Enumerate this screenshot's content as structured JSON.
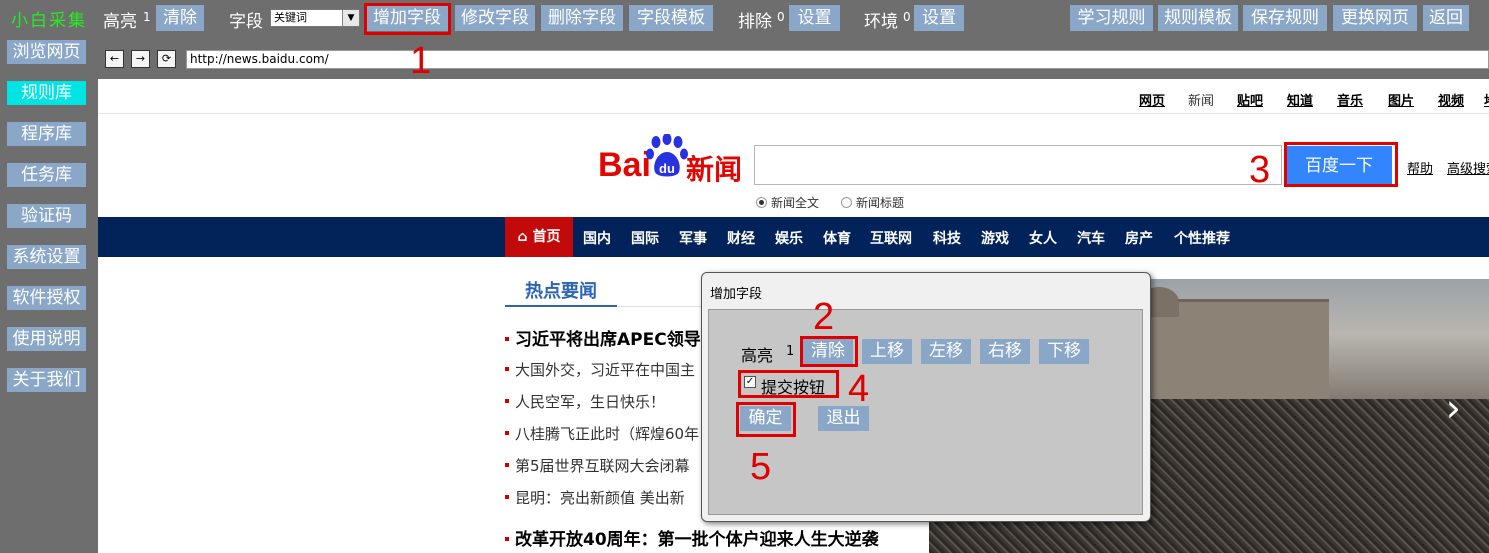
{
  "toolbar": {
    "brand": "小白采集",
    "highlight_label": "高亮",
    "highlight_count": "1",
    "clear": "清除",
    "field_label": "字段",
    "field_select": "关键词",
    "add_field": "增加字段",
    "edit_field": "修改字段",
    "delete_field": "删除字段",
    "field_template": "字段模板",
    "exclude_label": "排除",
    "exclude_count": "0",
    "exclude_settings": "设置",
    "env_label": "环境",
    "env_count": "0",
    "env_settings": "设置",
    "learn_rules": "学习规则",
    "rule_template": "规则模板",
    "save_rules": "保存规则",
    "change_page": "更换网页",
    "back": "返回"
  },
  "sidebar": {
    "items": [
      {
        "label": "浏览网页",
        "active": false
      },
      {
        "label": "规则库",
        "active": true
      },
      {
        "label": "程序库",
        "active": false
      },
      {
        "label": "任务库",
        "active": false
      },
      {
        "label": "验证码",
        "active": false
      },
      {
        "label": "系统设置",
        "active": false
      },
      {
        "label": "软件授权",
        "active": false
      },
      {
        "label": "使用说明",
        "active": false
      },
      {
        "label": "关于我们",
        "active": false
      }
    ]
  },
  "browser": {
    "back_glyph": "←",
    "forward_glyph": "→",
    "refresh_glyph": "⟳",
    "url": "http://news.baidu.com/"
  },
  "webpage": {
    "top_links": [
      "网页",
      "新闻",
      "贴吧",
      "知道",
      "音乐",
      "图片",
      "视频",
      "地"
    ],
    "logo_text": "Bai",
    "logo_du": "du",
    "logo_news": "新闻",
    "search_button": "百度一下",
    "help_link": "帮助",
    "advanced_link": "高级搜索",
    "radio_fulltext": "新闻全文",
    "radio_title": "新闻标题",
    "nav_home": "首页",
    "nav_items": [
      "国内",
      "国际",
      "军事",
      "财经",
      "娱乐",
      "体育",
      "互联网",
      "科技",
      "游戏",
      "女人",
      "汽车",
      "房产",
      "个性推荐"
    ],
    "hot_news_title": "热点要闻",
    "headlines": [
      "习近平将出席APEC领导",
      "大国外交，习近平在中国主",
      "人民空军，生日快乐！",
      "八桂腾飞正此时（辉煌60年",
      "第5届世界互联网大会闭幕",
      "昆明：亮出新颜值 美出新",
      "改革开放40周年：第一批个体户迎来人生大逆袭"
    ],
    "slider_arrow": "›"
  },
  "dialog": {
    "title": "增加字段",
    "highlight_label": "高亮",
    "highlight_count": "1",
    "clear": "清除",
    "move_up": "上移",
    "move_left": "左移",
    "move_right": "右移",
    "move_down": "下移",
    "submit_checkbox_label": "提交按钮",
    "submit_checked": true,
    "confirm": "确定",
    "exit": "退出"
  },
  "annotations": [
    "1",
    "2",
    "3",
    "4",
    "5"
  ],
  "colors": {
    "toolbar_bg": "#6e6e6e",
    "button_blue": "#8aa7c8",
    "active_cyan": "#00e4e4",
    "brand_green": "#22ee22",
    "annotation_red": "#e00000",
    "baidu_red": "#e10601",
    "baidu_blue": "#3385ff",
    "nav_navy": "#02225a"
  }
}
